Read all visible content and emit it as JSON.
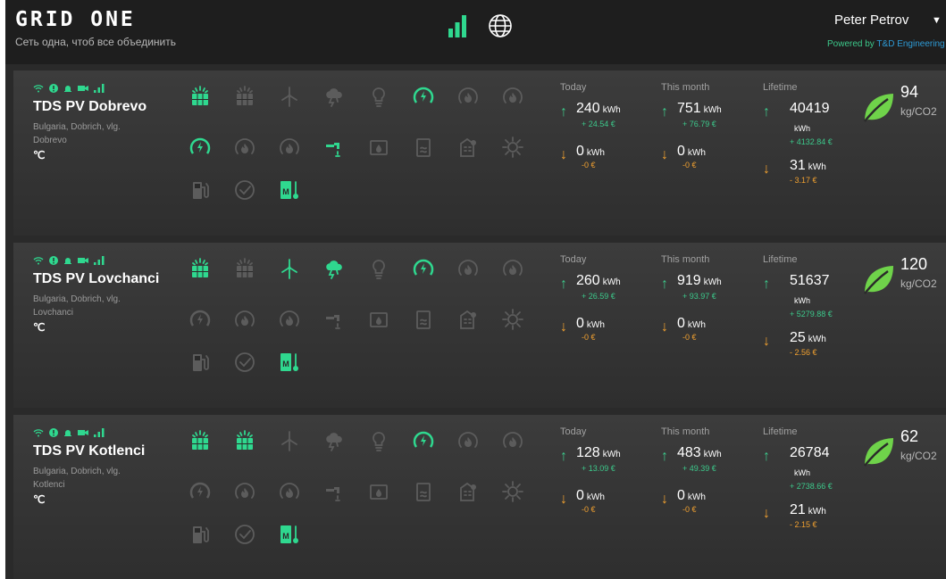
{
  "header": {
    "logo": "GRID ONE",
    "tagline": "Сеть одна, чтоб все объединить",
    "user_name": "Peter Petrov",
    "powered_by_prefix": "Powered by",
    "powered_by_brand": "T&D Engineering"
  },
  "labels": {
    "today": "Today",
    "month": "This month",
    "lifetime": "Lifetime",
    "temp": "℃"
  },
  "colors": {
    "accent": "#3cc98b",
    "consumption": "#f0a030",
    "active_icon": "#2fd88f",
    "inactive_icon": "#5c5c5c",
    "brand": "#2e9bd6"
  },
  "icons": [
    "solar-panel-icon",
    "solar-panel-icon",
    "wind-turbine-icon",
    "weather-cloud-icon",
    "bulb-icon",
    "power-meter-icon",
    "flame-gauge-icon",
    "flame-gauge-icon",
    "power-meter-icon",
    "flame-gauge-icon",
    "flame-gauge-icon",
    "water-tap-icon",
    "water-tank-icon",
    "boiler-icon",
    "building-icon",
    "sun-settings-icon",
    "charging-station-icon",
    "checkmark-icon",
    "thermometer-icon"
  ],
  "plants": [
    {
      "name": "TDS PV Dobrevo",
      "location_line1": "Bulgaria, Dobrich, vlg.",
      "location_line2": "Dobrevo",
      "active_icons": [
        true,
        false,
        false,
        false,
        false,
        true,
        false,
        false,
        true,
        false,
        false,
        true,
        false,
        false,
        false,
        false,
        false,
        false,
        true
      ],
      "today": {
        "produced": "240",
        "produced_unit": "kWh",
        "produced_eur": "+ 24.54 €",
        "consumed": "0",
        "consumed_unit": "kWh",
        "consumed_eur": "-0 €"
      },
      "month": {
        "produced": "751",
        "produced_unit": "kWh",
        "produced_eur": "+ 76.79 €",
        "consumed": "0",
        "consumed_unit": "kWh",
        "consumed_eur": "-0 €"
      },
      "lifetime": {
        "produced": "40419",
        "produced_unit": "kWh",
        "produced_eur": "+ 4132.84 €",
        "consumed": "31",
        "consumed_unit": "kWh",
        "consumed_eur": "- 3.17 €"
      },
      "co2": "94",
      "co2_unit": "kg/CO2"
    },
    {
      "name": "TDS PV Lovchanci",
      "location_line1": "Bulgaria, Dobrich, vlg.",
      "location_line2": "Lovchanci",
      "active_icons": [
        true,
        false,
        true,
        true,
        false,
        true,
        false,
        false,
        false,
        false,
        false,
        false,
        false,
        false,
        false,
        false,
        false,
        false,
        true
      ],
      "today": {
        "produced": "260",
        "produced_unit": "kWh",
        "produced_eur": "+ 26.59 €",
        "consumed": "0",
        "consumed_unit": "kWh",
        "consumed_eur": "-0 €"
      },
      "month": {
        "produced": "919",
        "produced_unit": "kWh",
        "produced_eur": "+ 93.97 €",
        "consumed": "0",
        "consumed_unit": "kWh",
        "consumed_eur": "-0 €"
      },
      "lifetime": {
        "produced": "51637",
        "produced_unit": "kWh",
        "produced_eur": "+ 5279.88 €",
        "consumed": "25",
        "consumed_unit": "kWh",
        "consumed_eur": "- 2.56 €"
      },
      "co2": "120",
      "co2_unit": "kg/CO2"
    },
    {
      "name": "TDS PV Kotlenci",
      "location_line1": "Bulgaria, Dobrich, vlg.",
      "location_line2": "Kotlenci",
      "active_icons": [
        true,
        true,
        false,
        false,
        false,
        true,
        false,
        false,
        false,
        false,
        false,
        false,
        false,
        false,
        false,
        false,
        false,
        false,
        true
      ],
      "today": {
        "produced": "128",
        "produced_unit": "kWh",
        "produced_eur": "+ 13.09 €",
        "consumed": "0",
        "consumed_unit": "kWh",
        "consumed_eur": "-0 €"
      },
      "month": {
        "produced": "483",
        "produced_unit": "kWh",
        "produced_eur": "+ 49.39 €",
        "consumed": "0",
        "consumed_unit": "kWh",
        "consumed_eur": "-0 €"
      },
      "lifetime": {
        "produced": "26784",
        "produced_unit": "kWh",
        "produced_eur": "+ 2738.66 €",
        "consumed": "21",
        "consumed_unit": "kWh",
        "consumed_eur": "- 2.15 €"
      },
      "co2": "62",
      "co2_unit": "kg/CO2"
    }
  ]
}
